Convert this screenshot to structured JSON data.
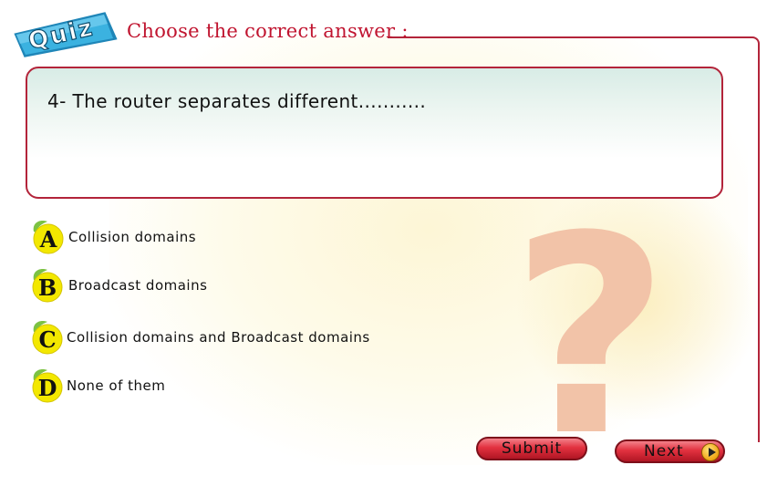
{
  "quiz_badge": {
    "text": "Quiz"
  },
  "heading": "Choose the correct answer :",
  "question": {
    "text": "4- The router separates different..........."
  },
  "options": [
    {
      "letter": "A",
      "label": "Collision domains"
    },
    {
      "letter": "B",
      "label": "Broadcast domains"
    },
    {
      "letter": "C",
      "label": "Collision domains and Broadcast domains"
    },
    {
      "letter": "D",
      "label": "None of them"
    }
  ],
  "buttons": {
    "submit": "Submit",
    "next": "Next"
  },
  "colors": {
    "accent": "#b3243a",
    "heading": "#c0142f",
    "option_ball": "#f3e800",
    "option_leaf": "#7cc243"
  },
  "icons": {
    "background": "question-mark-icon",
    "next": "play-icon"
  }
}
